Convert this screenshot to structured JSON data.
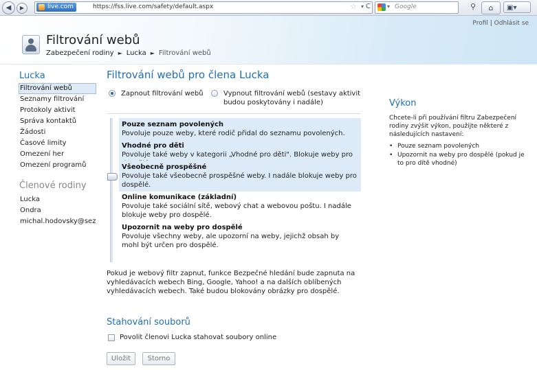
{
  "browser": {
    "site_badge": "live.com",
    "url": "https://fss.live.com/safety/default.aspx",
    "search_placeholder": "Google"
  },
  "header": {
    "profile_link": "Profil",
    "separator": "|",
    "signout_link": "Odhlásit se",
    "title": "Filtrování webů",
    "breadcrumb": [
      "Zabezpečení rodiny",
      "Lucka",
      "Filtrování webů"
    ]
  },
  "sidebar": {
    "member_title": "Lucka",
    "items": [
      {
        "label": "Filtrování webů",
        "active": true
      },
      {
        "label": "Seznamy filtrování"
      },
      {
        "label": "Protokoly aktivit"
      },
      {
        "label": "Správa kontaktů"
      },
      {
        "label": "Žádosti"
      },
      {
        "label": "Časové limity"
      },
      {
        "label": "Omezení her"
      },
      {
        "label": "Omezení programů"
      }
    ],
    "family_title": "Členové rodiny",
    "family": [
      {
        "label": "Lucka"
      },
      {
        "label": "Ondra"
      },
      {
        "label": "michal.hodovsky@seznam"
      }
    ]
  },
  "main": {
    "title": "Filtrování webů pro člena Lucka",
    "radio_on_label": "Zapnout filtrování webů",
    "radio_off_label_1": "Vypnout filtrování webů (sestavy aktivit",
    "radio_off_label_2": "budou poskytovány i nadále)",
    "levels": [
      {
        "title": "Pouze seznam povolených",
        "desc": "Povoluje pouze weby, které rodič přidal do seznamu povolených."
      },
      {
        "title": "Vhodné pro děti",
        "desc": "Povoluje také weby v kategorii „Vhodné pro děti\". Blokuje weby pro dospělé."
      },
      {
        "title": "Všeobecně prospěšné",
        "desc": "Povoluje také všeobecně prospěšné weby. I nadále blokuje weby pro dospělé."
      },
      {
        "title": "Online komunikace (základní)",
        "desc": "Povoluje také sociální sítě, webový chat a webovou poštu. I nadále blokuje weby pro dospělé."
      },
      {
        "title": "Upozornit na weby pro dospělé",
        "desc": "Povoluje všechny weby, ale upozorní na weby, jejichž obsah by mohl být určen pro dospělé."
      }
    ],
    "selected_level": "Všeobecně prospěšné",
    "info": "Pokud je webový filtr zapnut, funkce Bezpečné hledání bude zapnuta na vyhledávacích webech Bing, Google, Yahoo! a na dalších oblíbených vyhledávacích webech. Také budou blokovány obrázky pro dospělé.",
    "downloads_title": "Stahování souborů",
    "downloads_checkbox": "Povolit členovi Lucka stahovat soubory online",
    "save_button": "Uložit",
    "cancel_button": "Storno"
  },
  "right_panel": {
    "title": "Výkon",
    "text": "Chcete-li při používání filtru Zabezpečení rodiny zvýšit výkon, použijte některé z následujících nastavení:",
    "bullets": [
      "Pouze seznam povolených",
      "Upozornit na weby pro dospělé (pokud je to pro dítě vhodné)"
    ]
  },
  "colors": {
    "accent": "#1f6fb5",
    "highlight": "#ddeaf8"
  }
}
